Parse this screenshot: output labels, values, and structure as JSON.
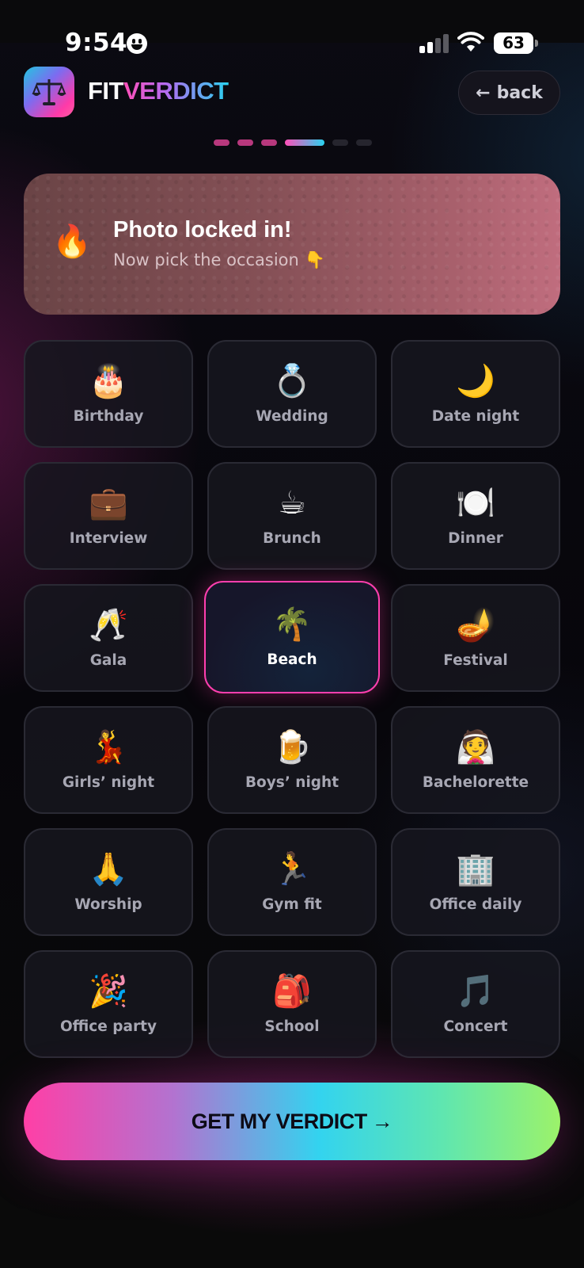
{
  "status_bar": {
    "time": "9:54",
    "battery": "63"
  },
  "header": {
    "brand_part1": "FIT",
    "brand_part2": "VERDICT",
    "back_label": "back",
    "back_arrow": "←",
    "logo_icon": "scales-icon"
  },
  "progress": {
    "total_steps": 6,
    "current_step": 4
  },
  "banner": {
    "emoji": "🔥",
    "title": "Photo locked in!",
    "subtitle": "Now pick the occasion 👇"
  },
  "occasions": [
    {
      "emoji": "🎂",
      "label": "Birthday"
    },
    {
      "emoji": "💍",
      "label": "Wedding"
    },
    {
      "emoji": "🌙",
      "label": "Date night"
    },
    {
      "emoji": "💼",
      "label": "Interview"
    },
    {
      "emoji": "☕",
      "label": "Brunch"
    },
    {
      "emoji": "🍽️",
      "label": "Dinner"
    },
    {
      "emoji": "🥂",
      "label": "Gala"
    },
    {
      "emoji": "🌴",
      "label": "Beach"
    },
    {
      "emoji": "🪔",
      "label": "Festival"
    },
    {
      "emoji": "💃",
      "label": "Girls’ night"
    },
    {
      "emoji": "🍺",
      "label": "Boys’ night"
    },
    {
      "emoji": "👰",
      "label": "Bachelorette"
    },
    {
      "emoji": "🙏",
      "label": "Worship"
    },
    {
      "emoji": "🏃",
      "label": "Gym fit"
    },
    {
      "emoji": "🏢",
      "label": "Office daily"
    },
    {
      "emoji": "🎉",
      "label": "Office party"
    },
    {
      "emoji": "🎒",
      "label": "School"
    },
    {
      "emoji": "🎵",
      "label": "Concert"
    }
  ],
  "selected_occasion": "Beach",
  "cta": {
    "label": "GET MY VERDICT",
    "arrow": "→"
  },
  "colors": {
    "accent_pink": "#ff3fae",
    "accent_cyan": "#29d3f0",
    "accent_green": "#9cf26a",
    "card_bg": "#16161e"
  }
}
